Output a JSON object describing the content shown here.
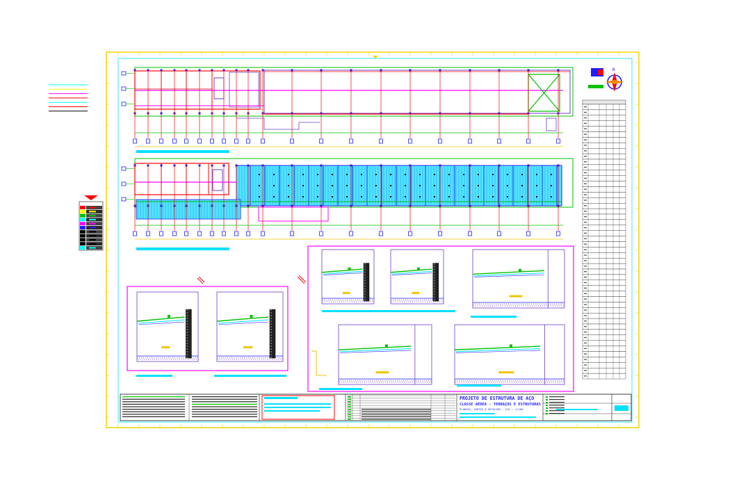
{
  "sheet": {
    "title_main": "PROJETO DE ESTRUTURA DE AÇO",
    "title_sub": "CLASSE AÉREA - TERRAÇOS E ESTRUTURAS",
    "title_desc": "PLANTAS, CORTES E DETALHES - ESC.: 1/100",
    "north_label": "N"
  },
  "colors": {
    "frame": "#f2d400",
    "plan": "#00c000",
    "walls": "#ff0000",
    "purple": "#6e3dc9",
    "cyan": "#00e0ff",
    "magenta": "#ff00ff",
    "deck": "#4ee8ff",
    "blue": "#1d1dff",
    "dim": "#f2c500"
  },
  "layer_legend": [
    {
      "color": "#00ffff"
    },
    {
      "color": "#ffff00"
    },
    {
      "color": "#ff00ff"
    },
    {
      "color": "#ff0000"
    },
    {
      "color": "#00ffff"
    },
    {
      "color": "#ff0000"
    },
    {
      "color": "#000000"
    }
  ],
  "left_table_rows": [
    {
      "color": "#ff0000"
    },
    {
      "color": "#ffff00"
    },
    {
      "color": "#00c000"
    },
    {
      "color": "#00ffff"
    },
    {
      "color": "#ff00ff"
    },
    {
      "color": "#1d1dff"
    },
    {
      "color": "#000000"
    },
    {
      "color": "#000000"
    },
    {
      "color": "#000000"
    },
    {
      "color": "#000000"
    },
    {
      "color": "#00ffff"
    }
  ],
  "schedule": {
    "rows": 50
  }
}
